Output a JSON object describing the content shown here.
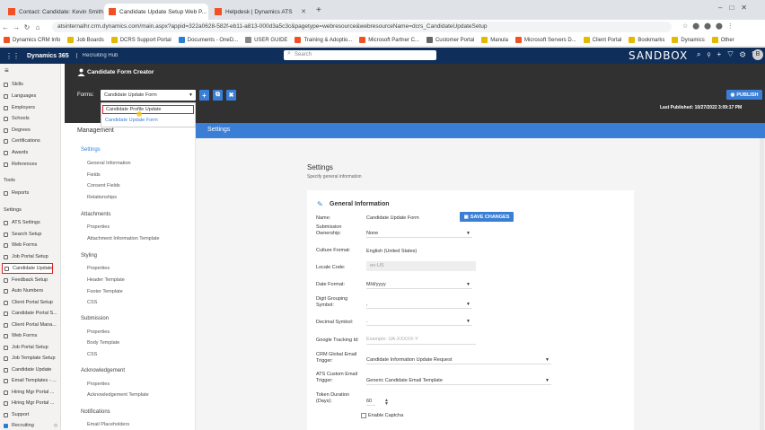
{
  "browser": {
    "tabs": [
      {
        "label": "Contact: Candidate: Kevin Smith",
        "active": false
      },
      {
        "label": "Candidate Update Setup Web P...",
        "active": true
      },
      {
        "label": "Helpdesk | Dynamics ATS",
        "active": false
      }
    ],
    "url": "atsinternalhr.crm.dynamics.com/main.aspx?appid=322a0628-582f-eb11-a813-000d3a5c3c&pagetype=webresource&webresourceName=dcrs_CandidateUpdateSetup",
    "bookmarks": [
      "Dynamics CRM Info",
      "Job Boards",
      "DCRS Support Portal",
      "Documents - OneD...",
      "USER GUIDE",
      "Training & Adoptio...",
      "Microsoft Partner C...",
      "Customer Portal",
      "Manula",
      "Microsoft Servers D...",
      "Client Portal",
      "Bookmarks",
      "Dynamics",
      "Other"
    ]
  },
  "app": {
    "name": "Dynamics 365",
    "hub": "Recruiting Hub",
    "search_placeholder": "Search",
    "env": "SANDBOX",
    "avatar": "B"
  },
  "leftnav": {
    "items_top": [
      "Skills",
      "Languages",
      "Employers",
      "Schools",
      "Degrees",
      "Certifications",
      "Awards",
      "References"
    ],
    "tools_label": "Tools",
    "tools_items": [
      "Reports"
    ],
    "settings_label": "Settings",
    "settings_items": [
      "ATS Settings",
      "Search Setup",
      "Web Forms",
      "Job Portal Setup",
      "Candidate Update",
      "Feedback Setup",
      "Auto Numbers",
      "Client Portal Setup",
      "Candidate Portal S...",
      "Client Portal Mana...",
      "Web Forms",
      "Job Portal Setup",
      "Job Template Setup",
      "Candidate Update",
      "Email Templates - ...",
      "Hiring Mgr Portal ...",
      "Hiring Mgr Portal ...",
      "Support"
    ],
    "area": "Recruiting"
  },
  "creator": {
    "title": "Candidate Form Creator",
    "forms_label": "Forms:",
    "selected_form": "Candidate Update Form",
    "dropdown_options": [
      "Candidate Profile Update",
      "Candidate Update Form"
    ],
    "publish_label": "PUBLISH",
    "last_published": "Last Published: 10/27/2022 3:09:17 PM"
  },
  "panel": {
    "management": "Management",
    "settings_tab": "Settings",
    "sections": [
      {
        "title": "Settings",
        "items": [
          "General Information",
          "Fields",
          "Consent Fields",
          "Relationships"
        ]
      },
      {
        "title": "Attachments",
        "items": [
          "Properties",
          "Attachment Information Template"
        ]
      },
      {
        "title": "Styling",
        "items": [
          "Properties",
          "Header Template",
          "Footer Template",
          "CSS"
        ]
      },
      {
        "title": "Submission",
        "items": [
          "Properties",
          "Body Template",
          "CSS"
        ]
      },
      {
        "title": "Acknowledgement",
        "items": [
          "Properties",
          "Acknowledgement Template"
        ]
      },
      {
        "title": "Notifications",
        "items": [
          "Email Placeholders"
        ]
      }
    ]
  },
  "settings": {
    "title": "Settings",
    "subtitle": "Specify general information",
    "section": "General Information",
    "save_label": "SAVE CHANGES",
    "fields": {
      "name_label": "Name:",
      "name_value": "Candidate Update Form",
      "sub_label": "Submission Ownership:",
      "sub_value": "None",
      "culture_label": "Culture Format:",
      "culture_value": "English (United States)",
      "locale_label": "Locale Code:",
      "locale_value": "en-US",
      "date_label": "Date Format:",
      "date_value": "M/d/yyyy",
      "digit_label": "Digit Grouping Symbol:",
      "digit_value": ",",
      "decimal_label": "Decimal Symbol:",
      "decimal_value": ".",
      "ga_label": "Google Tracking Id:",
      "ga_placeholder": "Example: UA-XXXXX-Y",
      "crm_label": "CRM Global Email Trigger:",
      "crm_value": "Candidate Information Update Request",
      "ats_label": "ATS Custom Email Trigger:",
      "ats_value": "Generic Candidate Email Template",
      "token_label": "Token Duration (Days):",
      "token_value": "60",
      "captcha_label": "Enable Captcha"
    }
  }
}
